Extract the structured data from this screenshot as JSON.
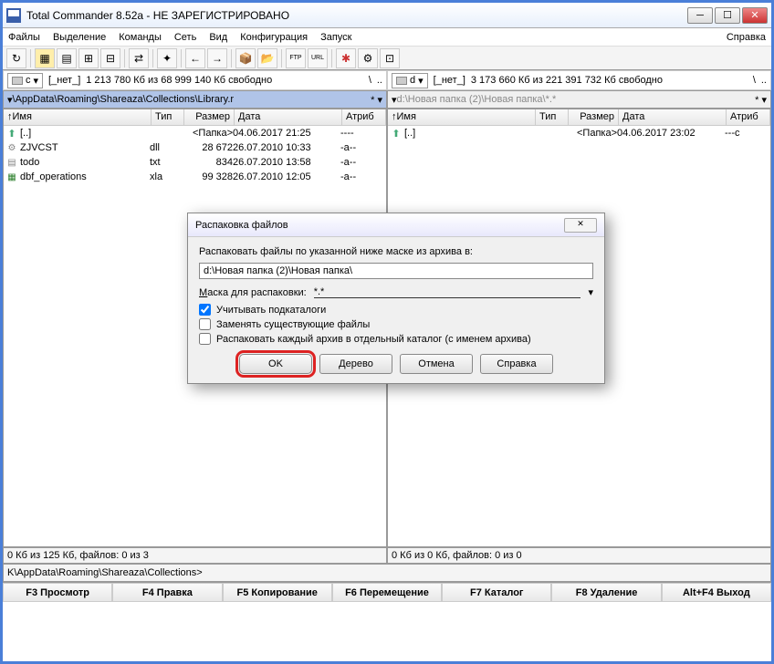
{
  "title": "Total Commander 8.52a - НЕ ЗАРЕГИСТРИРОВАНО",
  "menu": [
    "Файлы",
    "Выделение",
    "Команды",
    "Сеть",
    "Вид",
    "Конфигурация",
    "Запуск"
  ],
  "menu_right": "Справка",
  "left": {
    "drive": "c",
    "drive_label": "[_нет_]",
    "space": "1 213 780 Кб из 68 999 140 Кб свободно",
    "path": "\\AppData\\Roaming\\Shareaza\\Collections\\Library.r",
    "cols": {
      "name": "Имя",
      "type": "Тип",
      "size": "Размер",
      "date": "Дата",
      "attr": "Атриб"
    },
    "rows": [
      {
        "icon": "up",
        "name": "[..]",
        "type": "",
        "size": "<Папка>",
        "date": "04.06.2017 21:25",
        "attr": "----"
      },
      {
        "icon": "dll",
        "name": "ZJVCST",
        "type": "dll",
        "size": "28 672",
        "date": "26.07.2010 10:33",
        "attr": "-a--"
      },
      {
        "icon": "txt",
        "name": "todo",
        "type": "txt",
        "size": "834",
        "date": "26.07.2010 13:58",
        "attr": "-a--"
      },
      {
        "icon": "xls",
        "name": "dbf_operations",
        "type": "xla",
        "size": "99 328",
        "date": "26.07.2010 12:05",
        "attr": "-a--"
      }
    ],
    "status": "0 Кб из 125 Кб, файлов: 0 из 3"
  },
  "right": {
    "drive": "d",
    "drive_label": "[_нет_]",
    "space": "3 173 660 Кб из 221 391 732 Кб свободно",
    "path": "d:\\Новая папка (2)\\Новая папка\\*.*",
    "cols": {
      "name": "Имя",
      "type": "Тип",
      "size": "Размер",
      "date": "Дата",
      "attr": "Атриб"
    },
    "rows": [
      {
        "icon": "up",
        "name": "[..]",
        "type": "",
        "size": "<Папка>",
        "date": "04.06.2017 23:02",
        "attr": "---c"
      }
    ],
    "status": "0 Кб из 0 Кб, файлов: 0 из 0"
  },
  "cmdline": "K\\AppData\\Roaming\\Shareaza\\Collections>",
  "fkeys": [
    "F3 Просмотр",
    "F4 Правка",
    "F5 Копирование",
    "F6 Перемещение",
    "F7 Каталог",
    "F8 Удаление",
    "Alt+F4 Выход"
  ],
  "dialog": {
    "title": "Распаковка файлов",
    "prompt": "Распаковать файлы по указанной ниже маске из архива в:",
    "path": "d:\\Новая папка (2)\\Новая папка\\",
    "mask_label": "Маска для распаковки:",
    "mask_value": "*.*",
    "check1": "Учитывать подкаталоги",
    "check2": "Заменять существующие файлы",
    "check3": "Распаковать каждый архив в отдельный каталог (с именем архива)",
    "ok": "OK",
    "tree": "Дерево",
    "cancel": "Отмена",
    "help": "Справка"
  }
}
